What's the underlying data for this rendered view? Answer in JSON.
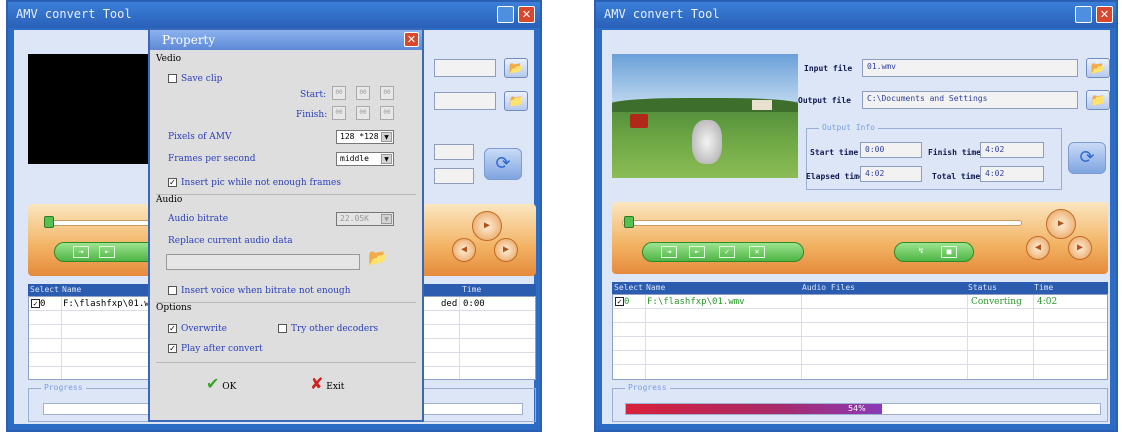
{
  "left": {
    "title": "AMV convert Tool",
    "list_headers": [
      "Select",
      "Name",
      "Time"
    ],
    "row": {
      "num": "0",
      "name": "F:\\flashfxp\\01.wm",
      "status": "ded",
      "time": "0:00"
    },
    "progress_label": "Progress"
  },
  "dialog": {
    "title": "Property",
    "video_section": "Vedio",
    "save_clip": "Save clip",
    "start_label": "Start:",
    "finish_label": "Finish:",
    "time_digits": [
      "00",
      "00",
      "00"
    ],
    "pixels_label": "Pixels of AMV",
    "pixels_value": "128 *128",
    "fps_label": "Frames per second",
    "fps_value": "middle",
    "insert_pic": "Insert pic while not enough frames",
    "audio_section": "Audio",
    "audio_bitrate_label": "Audio bitrate",
    "audio_bitrate_value": "22.05K",
    "replace_audio": "Replace current audio data",
    "insert_voice": "Insert voice when bitrate not enough",
    "options_section": "Options",
    "overwrite": "Overwrite",
    "try_decoders": "Try other decoders",
    "play_after": "Play after convert",
    "ok": "OK",
    "exit": "Exit"
  },
  "right": {
    "title": "AMV convert Tool",
    "input_label": "Input file",
    "input_value": "01.wmv",
    "output_label": "Output file",
    "output_value": "C:\\Documents and Settings",
    "output_info": "Output Info",
    "start_time_label": "Start time",
    "start_time": "0:00",
    "finish_time_label": "Finish time",
    "finish_time": "4:02",
    "elapsed_label": "Elapsed time",
    "elapsed": "4:02",
    "total_label": "Total time",
    "total": "4:02",
    "list_headers": [
      "Select",
      "Name",
      "Audio Files",
      "Status",
      "Time"
    ],
    "row": {
      "num": "0",
      "name": "F:\\flashfxp\\01.wmv",
      "audio": "",
      "status": "Converting",
      "time": "4:02"
    },
    "progress_label": "Progress",
    "progress_text": "54%",
    "progress": 0.54
  },
  "colors": {
    "accent": "#2d6cc4",
    "progress_red": "#d8203a",
    "progress_purple": "#8a3ab8"
  }
}
